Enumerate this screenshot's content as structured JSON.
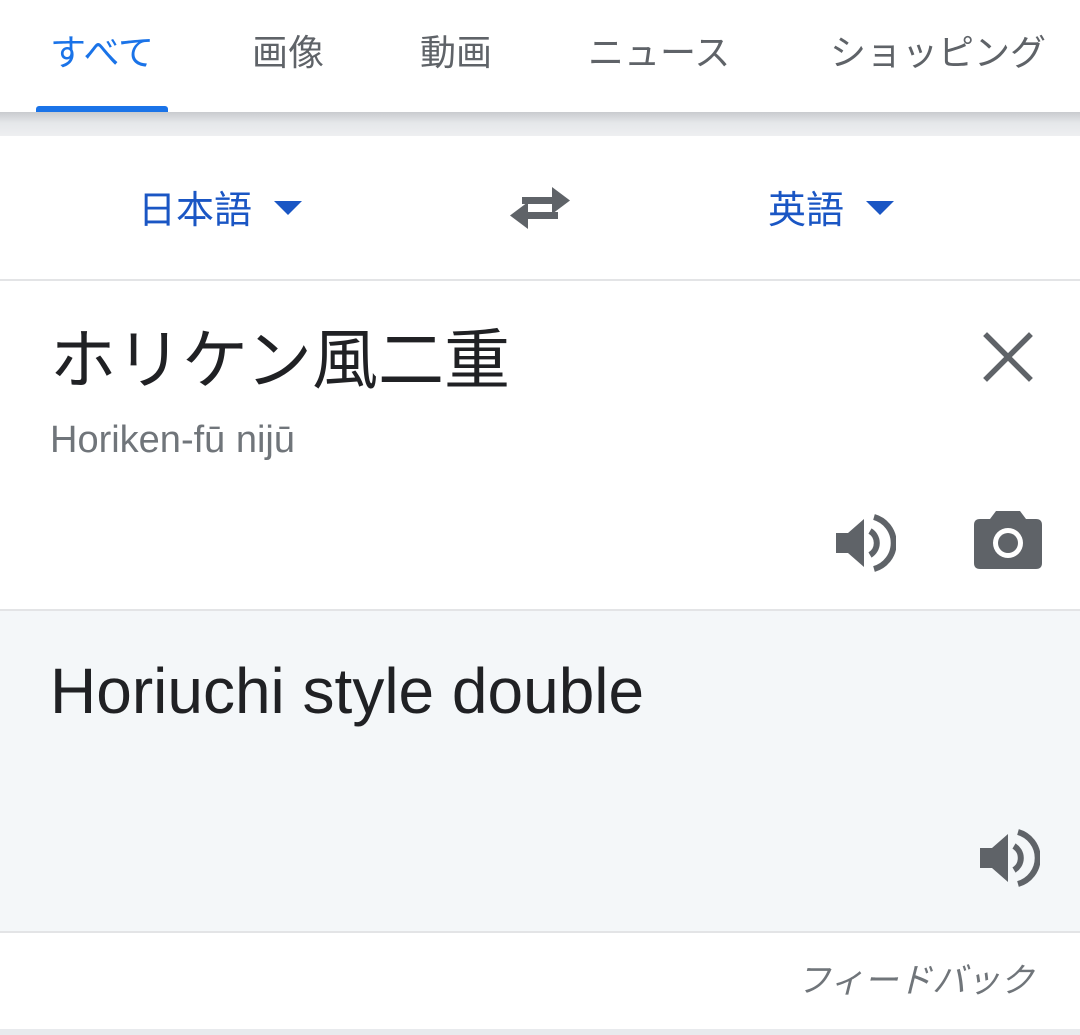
{
  "tabs": [
    {
      "label": "すべて",
      "active": true
    },
    {
      "label": "画像",
      "active": false
    },
    {
      "label": "動画",
      "active": false
    },
    {
      "label": "ニュース",
      "active": false
    },
    {
      "label": "ショッピング",
      "active": false
    }
  ],
  "translator": {
    "source_language": "日本語",
    "target_language": "英語",
    "source_text": "ホリケン風二重",
    "source_romanization": "Horiken-fū nijū",
    "translation": "Horiuchi style double",
    "feedback_label": "フィードバック"
  },
  "icons": {
    "swap": "swap-arrows-icon",
    "clear": "close-icon",
    "listen": "speaker-icon",
    "camera": "camera-icon",
    "dropdown": "caret-down-icon"
  },
  "colors": {
    "accent": "#1a73e8",
    "language_text": "#1a56c4",
    "icon_gray": "#5f6368",
    "result_background": "#f4f7f9"
  }
}
